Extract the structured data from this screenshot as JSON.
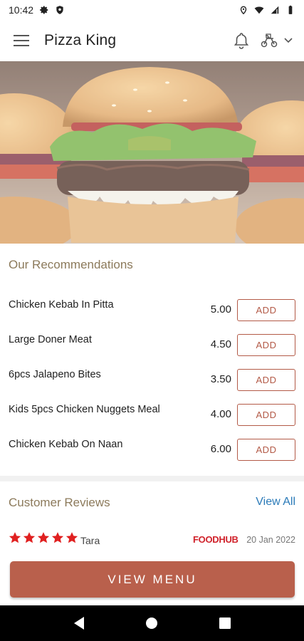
{
  "status_bar": {
    "time": "10:42",
    "left_icons": [
      "gear-icon",
      "shield-icon"
    ],
    "right_icons": [
      "location-icon",
      "wifi-icon",
      "signal-icon",
      "battery-icon"
    ]
  },
  "app_bar": {
    "title": "Pizza King",
    "icons": [
      "hamburger-menu-icon",
      "bell-icon",
      "delivery-icon",
      "chevron-down-icon"
    ]
  },
  "recommendations": {
    "title": "Our Recommendations",
    "add_label": "ADD",
    "items": [
      {
        "name": "Chicken Kebab In Pitta",
        "price": "5.00"
      },
      {
        "name": "Large Doner Meat",
        "price": "4.50"
      },
      {
        "name": "6pcs Jalapeno Bites",
        "price": "3.50"
      },
      {
        "name": "Kids 5pcs Chicken Nuggets Meal",
        "price": "4.00"
      },
      {
        "name": "Chicken Kebab On Naan",
        "price": "6.00"
      }
    ]
  },
  "reviews": {
    "title": "Customer Reviews",
    "view_all": "View All",
    "items": [
      {
        "rating": 5,
        "reviewer": "Tara",
        "source": "FOODHUB",
        "date": "20 Jan 2022"
      }
    ]
  },
  "view_menu_button": "VIEW MENU",
  "colors": {
    "accent": "#b9604c",
    "section_title": "#8c7a5b",
    "link": "#2a7ab8",
    "star": "#e02020",
    "foodhub_red": "#d0212a"
  },
  "nav_bar": {
    "icons": [
      "back-icon",
      "home-icon",
      "recents-icon"
    ]
  }
}
